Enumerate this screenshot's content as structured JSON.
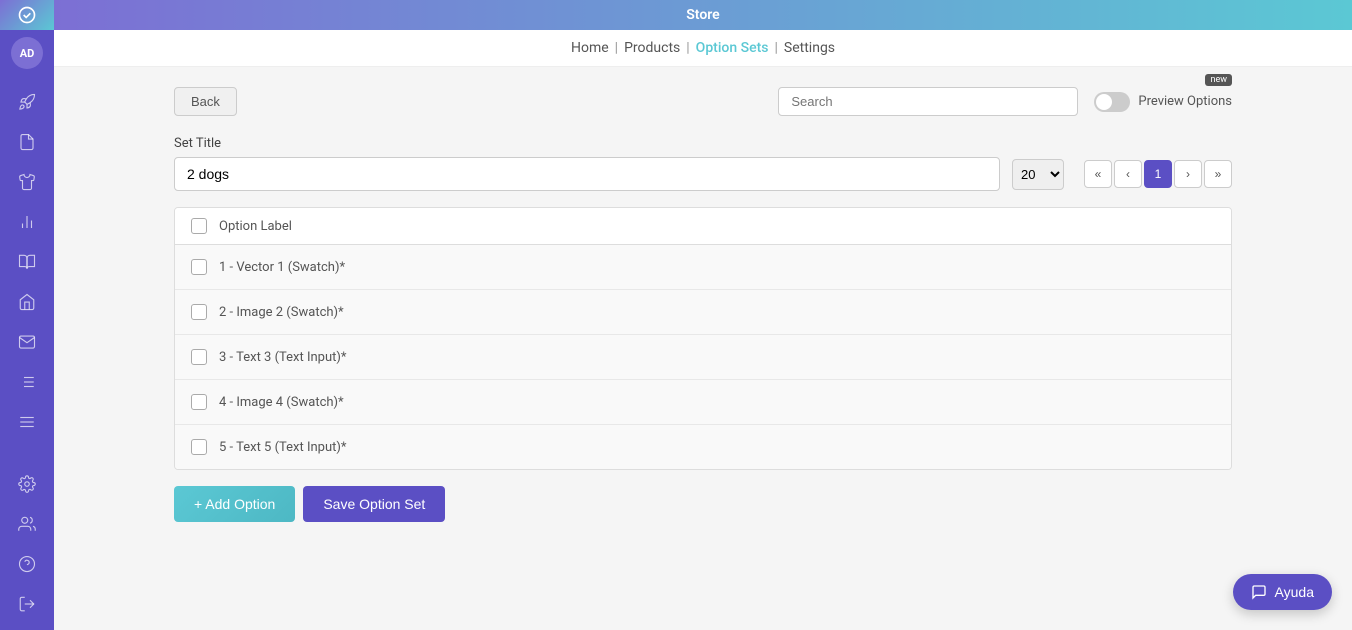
{
  "topbar": {
    "title": "Store"
  },
  "nav": {
    "items": [
      {
        "label": "Home",
        "active": false
      },
      {
        "label": "Products",
        "active": false
      },
      {
        "label": "Option Sets",
        "active": true
      },
      {
        "label": "Settings",
        "active": false
      }
    ]
  },
  "toolbar": {
    "back_label": "Back",
    "search_placeholder": "Search",
    "preview_label": "Preview Options",
    "new_badge": "new"
  },
  "form": {
    "set_title_label": "Set Title",
    "set_title_value": "2 dogs",
    "per_page": "20"
  },
  "pagination": {
    "first_label": "«",
    "prev_label": "‹",
    "current": "1",
    "next_label": "›",
    "last_label": "»"
  },
  "table": {
    "header_label": "Option Label",
    "rows": [
      {
        "label": "1 - Vector 1 (Swatch)*"
      },
      {
        "label": "2 - Image 2 (Swatch)*"
      },
      {
        "label": "3 - Text 3 (Text Input)*"
      },
      {
        "label": "4 - Image 4 (Swatch)*"
      },
      {
        "label": "5 - Text 5 (Text Input)*"
      }
    ]
  },
  "actions": {
    "add_label": "+ Add Option",
    "save_label": "Save Option Set"
  },
  "sidebar": {
    "avatar_initials": "AD",
    "items": [
      {
        "name": "rocket-icon",
        "icon": "🚀"
      },
      {
        "name": "document-icon",
        "icon": "📄"
      },
      {
        "name": "shirt-icon",
        "icon": "👕"
      },
      {
        "name": "chart-icon",
        "icon": "📊"
      },
      {
        "name": "notebook-icon",
        "icon": "📓"
      },
      {
        "name": "store-icon",
        "icon": "🏪"
      },
      {
        "name": "mail-icon",
        "icon": "✉"
      },
      {
        "name": "list-icon",
        "icon": "☰"
      },
      {
        "name": "menu-icon",
        "icon": "≡"
      },
      {
        "name": "settings-icon",
        "icon": "⚙"
      },
      {
        "name": "users-icon",
        "icon": "👥"
      },
      {
        "name": "help-icon",
        "icon": "❓"
      },
      {
        "name": "logout-icon",
        "icon": "⬚"
      }
    ]
  },
  "ayuda": {
    "label": "Ayuda"
  }
}
